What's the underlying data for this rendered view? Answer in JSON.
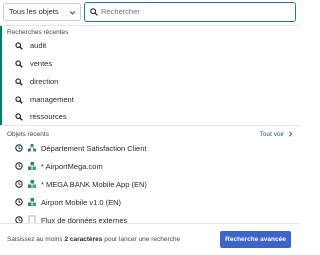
{
  "scope_select": {
    "value": "Tous les objets"
  },
  "search": {
    "placeholder": "Rechercher",
    "value": ""
  },
  "recent_searches": {
    "title": "Recherches récentes",
    "items": [
      {
        "label": "audit"
      },
      {
        "label": "ventes"
      },
      {
        "label": "direction"
      },
      {
        "label": "management"
      },
      {
        "label": "ressources"
      }
    ]
  },
  "recent_objects": {
    "title": "Objets récents",
    "see_all": "Tout voir",
    "items": [
      {
        "label": "Département Satisfaction Client",
        "type_icon": "cluster-icon"
      },
      {
        "label": "* AirportMega.com",
        "type_icon": "stacked-blocks-icon"
      },
      {
        "label": "* MEGA BANK Mobile App (EN)",
        "type_icon": "stacked-blocks-icon"
      },
      {
        "label": "Airport Mobile v1.0 (EN)",
        "type_icon": "stacked-blocks-icon"
      },
      {
        "label": "Flux de données externes",
        "type_icon": "document-icon"
      }
    ]
  },
  "footer": {
    "hint_before": "Saisissez au moins ",
    "hint_bold": "2 caractères",
    "hint_after": " pour lancer une recherche",
    "advanced_button": "Recherche avancée"
  },
  "colors": {
    "accent_blue": "#1b6fd6",
    "button_blue": "#3d64c8",
    "teal_accent": "#0b7a6e",
    "green_icon": "#2e8b57"
  }
}
